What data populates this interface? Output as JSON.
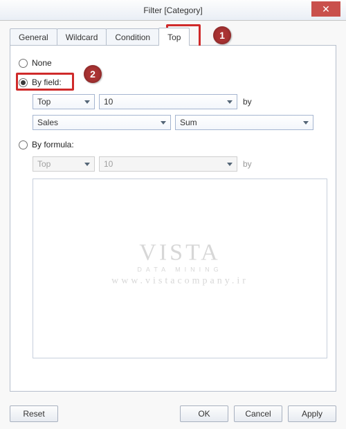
{
  "window": {
    "title": "Filter [Category]"
  },
  "tabs": {
    "general": "General",
    "wildcard": "Wildcard",
    "condition": "Condition",
    "top": "Top"
  },
  "callouts": {
    "c1": "1",
    "c2": "2"
  },
  "radios": {
    "none": "None",
    "by_field": "By field:",
    "by_formula": "By formula:"
  },
  "by_field": {
    "direction": "Top",
    "count": "10",
    "by_label": "by",
    "field": "Sales",
    "agg": "Sum"
  },
  "by_formula": {
    "direction": "Top",
    "count": "10",
    "by_label": "by"
  },
  "watermark": {
    "logo": "VISTA",
    "sub": "DATA MINING",
    "url": "www.vistacompany.ir"
  },
  "buttons": {
    "reset": "Reset",
    "ok": "OK",
    "cancel": "Cancel",
    "apply": "Apply"
  }
}
